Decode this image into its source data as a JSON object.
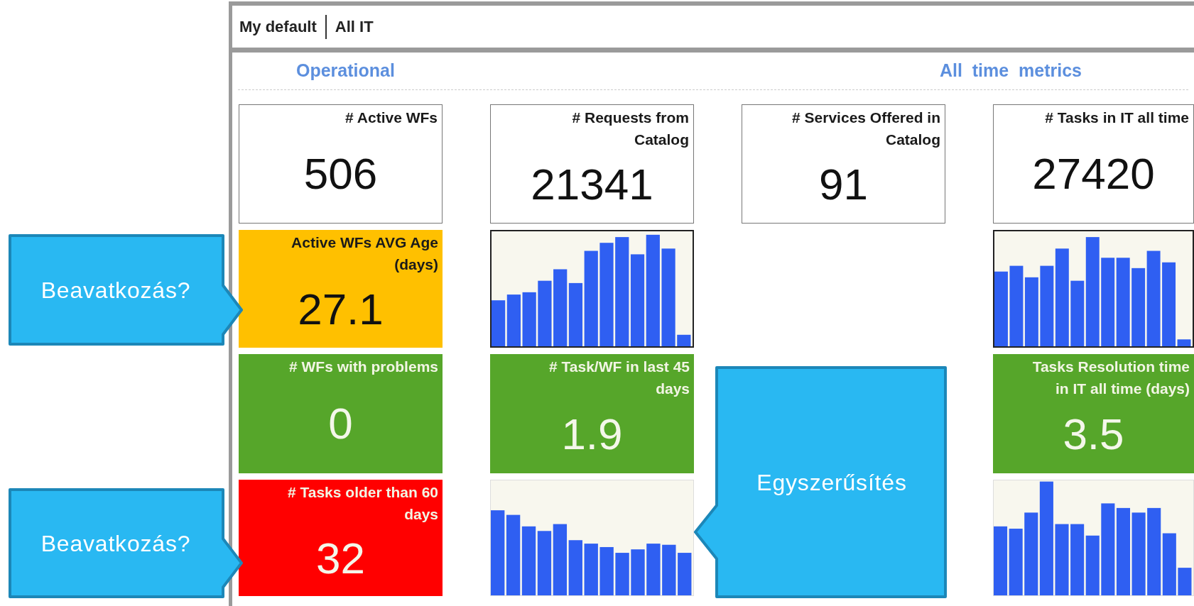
{
  "header": {
    "items": [
      {
        "label": "My default"
      },
      {
        "label": "All IT"
      }
    ]
  },
  "sections": [
    {
      "title": "Operational"
    },
    {
      "title": "All  time  metrics"
    }
  ],
  "columns": [
    {
      "tiles": [
        {
          "kind": "metric",
          "label": "# Active WFs",
          "value": "506",
          "color": "#ffffff"
        },
        {
          "kind": "metric",
          "label": "Active WFs AVG Age (days)",
          "value": "27.1",
          "color": "#ffc000"
        },
        {
          "kind": "metric",
          "label": "# WFs with problems",
          "value": "0",
          "color": "#56a62a"
        },
        {
          "kind": "metric",
          "label": "# Tasks older than 60 days",
          "value": "32",
          "color": "#ff0000"
        }
      ]
    },
    {
      "tiles": [
        {
          "kind": "metric",
          "label": "# Requests from Catalog",
          "value": "21341",
          "color": "#ffffff"
        },
        {
          "kind": "sparkline"
        },
        {
          "kind": "metric",
          "label": "# Task/WF in last 45 days",
          "value": "1.9",
          "color": "#56a62a"
        },
        {
          "kind": "sparkline"
        }
      ]
    },
    {
      "tiles": [
        {
          "kind": "metric",
          "label": "# Services Offered in Catalog",
          "value": "91",
          "color": "#ffffff"
        },
        {
          "kind": "empty"
        },
        {
          "kind": "empty"
        },
        {
          "kind": "empty"
        }
      ]
    },
    {
      "tiles": [
        {
          "kind": "metric",
          "label": "# Tasks in IT all time",
          "value": "27420",
          "color": "#ffffff"
        },
        {
          "kind": "sparkline"
        },
        {
          "kind": "metric",
          "label": "Tasks Resolution time in IT all time (days)",
          "value": "3.5",
          "color": "#56a62a"
        },
        {
          "kind": "sparkline"
        }
      ]
    }
  ],
  "callouts": [
    {
      "text": "Beavatkozás?",
      "kind": "right"
    },
    {
      "text": "Beavatkozás?",
      "kind": "right"
    },
    {
      "text": "Egyszerűsítés",
      "kind": "left"
    }
  ]
}
